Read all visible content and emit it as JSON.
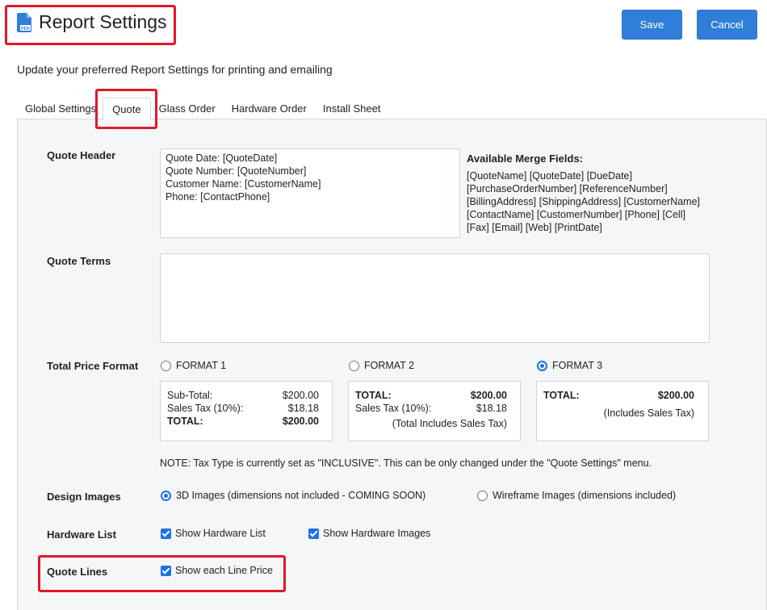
{
  "header": {
    "title": "Report Settings",
    "icon": "pdf-file-icon",
    "icon_text": "PDF"
  },
  "actions": {
    "save_label": "Save",
    "cancel_label": "Cancel",
    "accent": "#2f7fd8"
  },
  "subtitle": "Update your preferred Report Settings for printing and emailing",
  "tabs": [
    {
      "label": "Global Settings"
    },
    {
      "label": "Quote",
      "active": true
    },
    {
      "label": "Glass Order"
    },
    {
      "label": "Hardware Order"
    },
    {
      "label": "Install Sheet"
    }
  ],
  "quote_header": {
    "label": "Quote Header",
    "lines": [
      "Quote Date: [QuoteDate]",
      "Quote Number: [QuoteNumber]",
      "Customer Name: [CustomerName]",
      "Phone: [ContactPhone]"
    ]
  },
  "merge_fields": {
    "title": "Available Merge Fields:",
    "lines": [
      "[QuoteName] [QuoteDate] [DueDate]",
      "[PurchaseOrderNumber] [ReferenceNumber]",
      "[BillingAddress] [ShippingAddress] [CustomerName]",
      "[ContactName] [CustomerNumber] [Phone] [Cell]",
      "[Fax] [Email] [Web] [PrintDate]"
    ]
  },
  "quote_terms": {
    "label": "Quote Terms",
    "value": ""
  },
  "total_price_format": {
    "label": "Total Price Format",
    "options": [
      {
        "label": "FORMAT 1",
        "selected": false
      },
      {
        "label": "FORMAT 2",
        "selected": false
      },
      {
        "label": "FORMAT 3",
        "selected": true
      }
    ],
    "format1": {
      "subtotal_label": "Sub-Total:",
      "subtotal_value": "$200.00",
      "tax_label": "Sales Tax (10%):",
      "tax_value": "$18.18",
      "total_label": "TOTAL:",
      "total_value": "$200.00"
    },
    "format2": {
      "total_label": "TOTAL:",
      "total_value": "$200.00",
      "tax_label": "Sales Tax (10%):",
      "tax_value": "$18.18",
      "note": "(Total Includes Sales Tax)"
    },
    "format3": {
      "total_label": "TOTAL:",
      "total_value": "$200.00",
      "note": "(Includes Sales Tax)"
    },
    "tax_note": "NOTE: Tax Type is currently set as \"INCLUSIVE\". This can be only changed under the \"Quote Settings\" menu."
  },
  "design_images": {
    "label": "Design Images",
    "options": [
      {
        "label": "3D Images (dimensions not included - COMING SOON)",
        "selected": true
      },
      {
        "label": "Wireframe Images (dimensions included)",
        "selected": false
      }
    ]
  },
  "hardware_list": {
    "label": "Hardware List",
    "options": [
      {
        "label": "Show Hardware List",
        "checked": true
      },
      {
        "label": "Show Hardware Images",
        "checked": true
      }
    ]
  },
  "quote_lines": {
    "label": "Quote Lines",
    "options": [
      {
        "label": "Show each Line Price",
        "checked": true
      }
    ]
  },
  "highlight_color": "#e0192a"
}
